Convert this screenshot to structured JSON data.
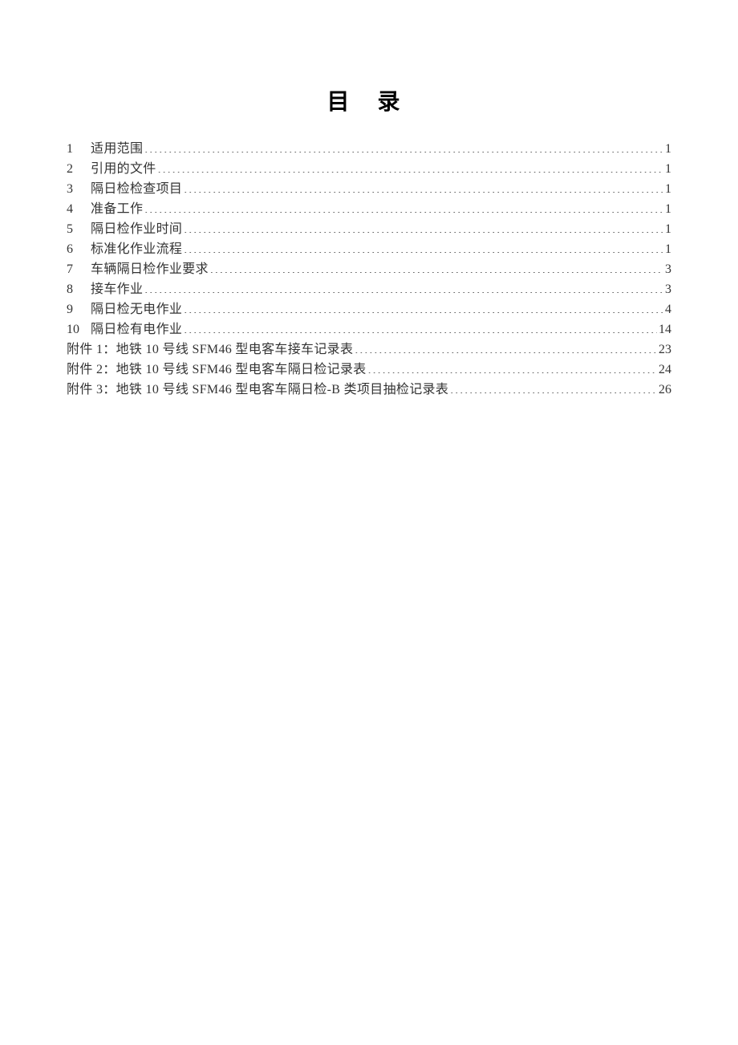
{
  "title": "目  录",
  "toc": [
    {
      "num": "1",
      "label": "适用范围 ",
      "page": "1"
    },
    {
      "num": "2",
      "label": "引用的文件 ",
      "page": "1"
    },
    {
      "num": "3",
      "label": "隔日检检查项目",
      "page": "1"
    },
    {
      "num": "4",
      "label": "准备工作",
      "page": "1"
    },
    {
      "num": "5",
      "label": "隔日检作业时间",
      "page": "1"
    },
    {
      "num": "6",
      "label": "标准化作业流程 ",
      "page": "1"
    },
    {
      "num": "7",
      "label": "车辆隔日检作业要求",
      "page": "3"
    },
    {
      "num": "8",
      "label": "接车作业",
      "page": "3"
    },
    {
      "num": "9",
      "label": "隔日检无电作业",
      "page": "4"
    },
    {
      "num": "10",
      "label": "隔日检有电作业",
      "page": "14"
    }
  ],
  "appendices": [
    {
      "label": "附件 1：地铁 10 号线 SFM46 型电客车接车记录表",
      "page": "23"
    },
    {
      "label": "附件 2：地铁 10 号线 SFM46 型电客车隔日检记录表",
      "page": "24"
    },
    {
      "label": "附件 3：地铁 10 号线 SFM46 型电客车隔日检-B 类项目抽检记录表 ",
      "page": "26"
    }
  ]
}
